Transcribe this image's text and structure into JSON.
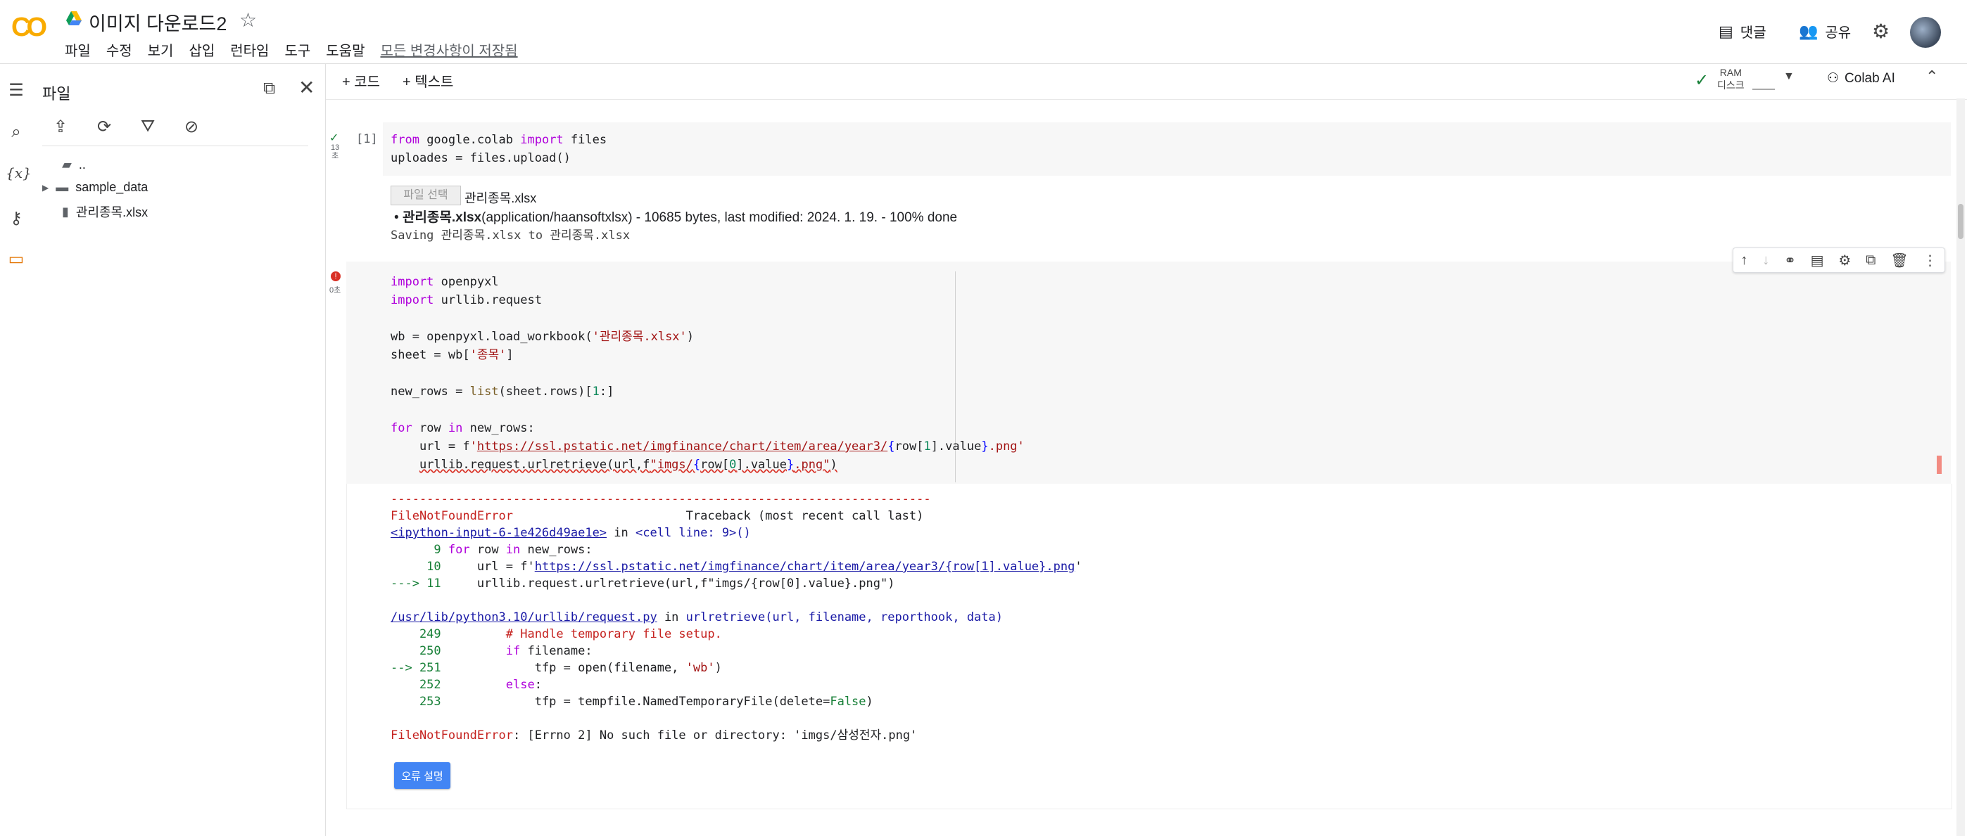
{
  "app": {
    "logo": "CO",
    "title": "이미지 다운로드2"
  },
  "menu": [
    "파일",
    "수정",
    "보기",
    "삽입",
    "런타임",
    "도구",
    "도움말"
  ],
  "saved_status": "모든 변경사항이 저장됨",
  "header_actions": {
    "comments": "댓글",
    "share": "공유"
  },
  "files_panel": {
    "title": "파일",
    "tree": [
      {
        "label": "..",
        "type": "parent"
      },
      {
        "label": "sample_data",
        "type": "folder"
      },
      {
        "label": "관리종목.xlsx",
        "type": "file"
      }
    ]
  },
  "toolbar": {
    "add_code": "+ 코드",
    "add_text": "+ 텍스트",
    "ram": "RAM",
    "disk": "디스크",
    "colab_ai": "Colab AI"
  },
  "cell1": {
    "exec_count": "[1]",
    "runtime": "13\n초",
    "code": [
      "from google.colab import files",
      "uploades = files.upload()"
    ],
    "file_button": "파일 선택",
    "chosen_file": "관리종목.xlsx",
    "upload_name": "관리종목.xlsx",
    "upload_info": "(application/haansoftxlsx) - 10685 bytes, last modified: 2024. 1. 19. - 100% done",
    "saving": "Saving 관리종목.xlsx to 관리종목.xlsx"
  },
  "cell2": {
    "runtime": "0초",
    "error": {
      "dashes": "---------------------------------------------------------------------------",
      "name": "FileNotFoundError",
      "traceback_label": "Traceback (most recent call last)",
      "input_ref": "<ipython-input-6-1e426d49ae1e>",
      "in_word": " in ",
      "cell_ref": "<cell line: 9>()",
      "lib_ref": "/usr/lib/python3.10/urllib/request.py",
      "func_ref": "urlretrieve(url, filename, reporthook, data)",
      "final": "[Errno 2] No such file or directory: 'imgs/삼성전자.png'"
    },
    "explain_button": "오류 설명"
  }
}
